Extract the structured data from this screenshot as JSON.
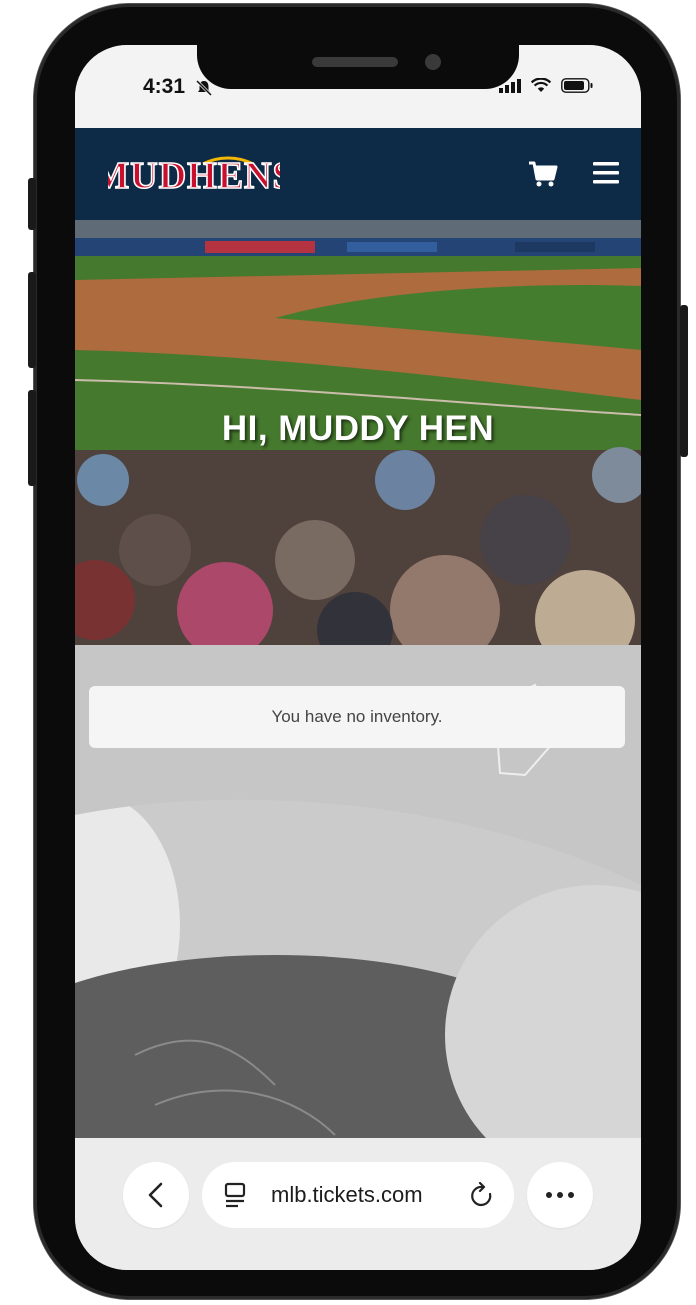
{
  "status_bar": {
    "time": "4:31"
  },
  "header": {
    "logo_text": "MUDHENS",
    "colors": {
      "navy": "#0d2a47",
      "brand_red": "#c8102e"
    }
  },
  "hero": {
    "greeting": "HI, MUDDY HEN"
  },
  "inventory": {
    "message": "You have no inventory."
  },
  "browser": {
    "url": "mlb.tickets.com"
  }
}
